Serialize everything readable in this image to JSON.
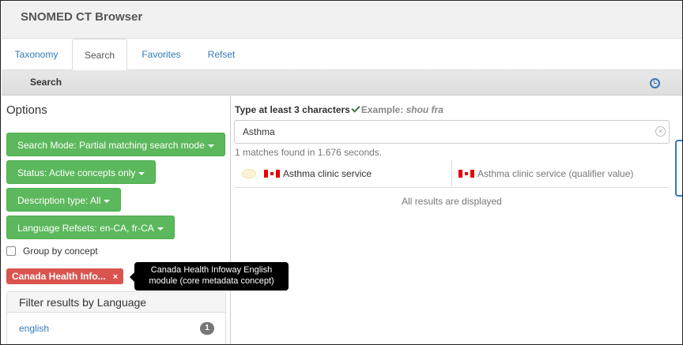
{
  "app": {
    "title": "SNOMED CT Browser"
  },
  "tabs": [
    {
      "label": "Taxonomy",
      "active": false
    },
    {
      "label": "Search",
      "active": true
    },
    {
      "label": "Favorites",
      "active": false
    },
    {
      "label": "Refset",
      "active": false
    }
  ],
  "strip": {
    "title": "Search",
    "icon": "history-icon"
  },
  "options": {
    "title": "Options",
    "search_mode": "Search Mode: Partial matching search mode",
    "status": "Status: Active concepts only",
    "description_type": "Description type: All",
    "language_refsets": "Language Refsets: en-CA, fr-CA",
    "group_by_concept": {
      "label": "Group by concept",
      "checked": false
    },
    "module_filter": {
      "label": "Canada Health Info...",
      "close": "×"
    },
    "tooltip": {
      "line1": "Canada Health Infoway English",
      "line2": "module (core metadata concept)"
    },
    "filter_language": {
      "title": "Filter results by Language",
      "items": [
        {
          "label": "english",
          "count": "1"
        }
      ]
    }
  },
  "search": {
    "hint": "Type at least 3 characters",
    "example_label": "Example:",
    "example_value": "shou fra",
    "value": "Asthma",
    "match_info": "1 matches found in 1.676 seconds.",
    "results": [
      {
        "term": "Asthma clinic service",
        "fsn": "Asthma clinic service (qualifier value)"
      }
    ],
    "all_displayed": "All results are displayed"
  },
  "colors": {
    "accent": "#337ab7",
    "success": "#5cb85c",
    "danger": "#d9534f"
  }
}
